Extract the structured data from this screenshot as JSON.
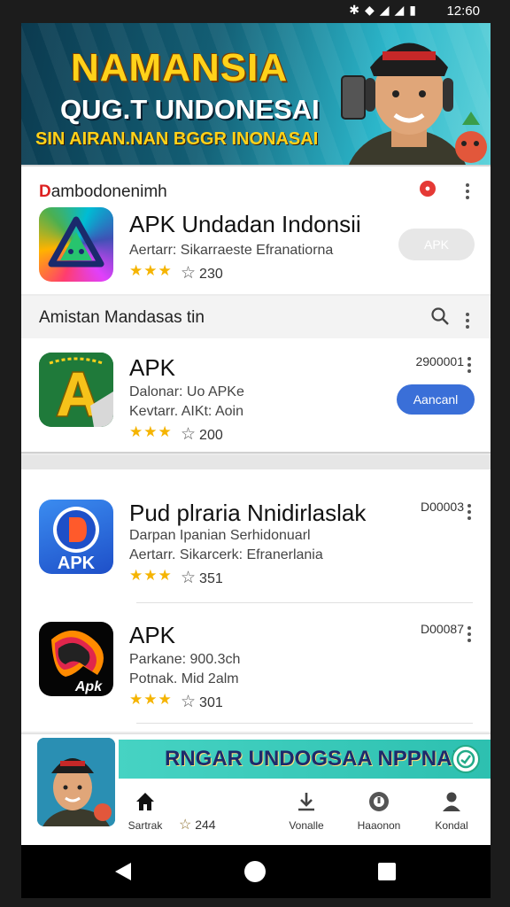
{
  "status_bar": {
    "time": "12:60",
    "icons": [
      "bluetooth-icon",
      "wifi-icon",
      "signal-icon",
      "signal-icon",
      "battery-icon"
    ]
  },
  "banner": {
    "line1": "NAMANSIA",
    "line2": "QUG.T UNDONESAI",
    "line3": "SIN AIRAN.NAN BGGR INONASAI"
  },
  "featured": {
    "section_title_initial": "D",
    "section_title_rest": "ambodonenimh",
    "app": {
      "title": "APK Undadan Indonsii",
      "subtitle": "Aertarr:  Sikarraeste  Efranatiorna",
      "stars": "★★★",
      "rating": "230",
      "button_label": "APK"
    }
  },
  "section2": {
    "label": "Amistan Mandasas tin"
  },
  "apps": [
    {
      "title": "APK",
      "line1": "Dalonar: Uo APKe",
      "line2": "Kevtarr. AIKt: Aoin",
      "stars": "★★★",
      "rating": "200",
      "size": "2900001",
      "button_label": "Aancanl"
    },
    {
      "title": "Pud plraria Nnidirlaslak",
      "line1": "Darpan Ipanian Serhidonuarl",
      "line2": "Aertarr. Sikarcerk:  Efranerlania",
      "stars": "★★★",
      "rating": "351",
      "size": "D00003"
    },
    {
      "title": "APK",
      "line1": "Parkane:  900.3ch",
      "line2": "Potnak.   Mid 2alm",
      "stars": "★★★",
      "rating": "301",
      "size": "D00087"
    }
  ],
  "bottom_banner": {
    "text": "RNGAR UNDOGSAA NPPNAHI"
  },
  "bottom_nav": {
    "items": [
      {
        "label": "Sartrak",
        "icon": "home-icon"
      },
      {
        "label": "Vonalle",
        "icon": "download-icon"
      },
      {
        "label": "Haaonon",
        "icon": "alert-icon"
      },
      {
        "label": "Kondal",
        "icon": "account-icon"
      }
    ],
    "rating": "244"
  },
  "colors": {
    "accent_blue": "#3a6fd8",
    "star_gold": "#f5b400",
    "alert_red": "#e53935"
  }
}
